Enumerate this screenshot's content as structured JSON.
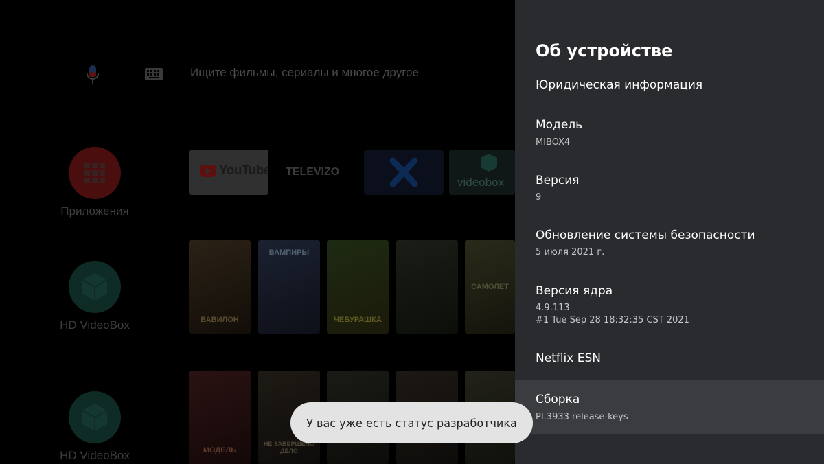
{
  "launcher": {
    "search_placeholder": "Ищите фильмы, сериалы и многое другое",
    "side_items": [
      {
        "label": "Приложения",
        "icon": "apps-grid-icon"
      },
      {
        "label": "HD VideoBox",
        "icon": "videobox-icon"
      },
      {
        "label": "HD VideoBox",
        "icon": "videobox-icon"
      }
    ],
    "channel_tiles": [
      {
        "label": "YouTube"
      },
      {
        "label": "TELEVIZO"
      },
      {
        "label": "X"
      },
      {
        "label": "videobox"
      }
    ],
    "poster_titles_row1": [
      "ВАВИЛОН",
      "ВАМПИРЫ",
      "ЧЕБУРАШКА",
      "",
      "САМОЛЕТ"
    ],
    "poster_titles_row2": [
      "МОДЕЛЬ",
      "НЕ ЗАВЕРШЕНО ДЕЛО",
      "",
      "",
      ""
    ]
  },
  "panel": {
    "title": "Об устройстве",
    "items": [
      {
        "title": "Юридическая информация"
      },
      {
        "title": "Модель",
        "subtitle": "MIBOX4"
      },
      {
        "title": "Версия",
        "subtitle": "9"
      },
      {
        "title": "Обновление системы безопасности",
        "subtitle": "5 июля 2021 г."
      },
      {
        "title": "Версия ядра",
        "subtitle": "4.9.113",
        "subtitle2": "#1 Tue Sep 28 18:32:35 CST 2021"
      },
      {
        "title": "Netflix ESN"
      },
      {
        "title": "Сборка",
        "subtitle": "PI.3933 release-keys",
        "selected": true
      }
    ]
  },
  "toast": {
    "text": "У вас уже есть статус разработчика"
  },
  "colors": {
    "panel_bg": "#2a2b2e",
    "selected_bg": "#3b3c40",
    "toast_bg": "#e3e3e3",
    "apps_red": "#4a0e0e",
    "videobox_green": "#0e2b25"
  }
}
